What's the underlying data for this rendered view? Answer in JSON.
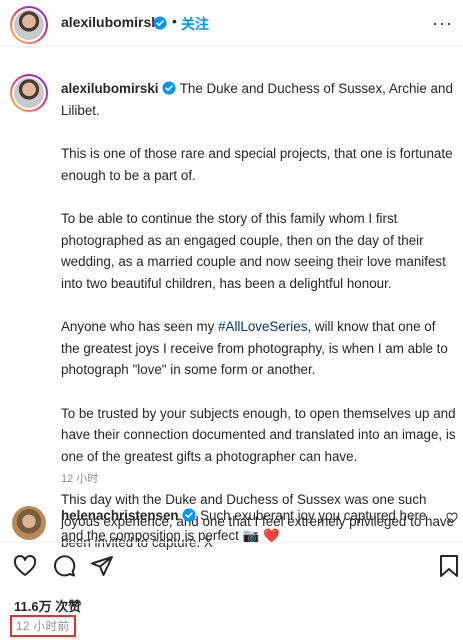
{
  "header": {
    "username": "alexilubomirski",
    "dot": "•",
    "follow_label": "关注",
    "more_label": "···"
  },
  "caption": {
    "username": "alexilubomirski",
    "paragraphs": [
      "The Duke and Duchess of Sussex, Archie and Lilibet.",
      "This is one of those rare and special projects, that one is fortunate enough to be a part of.",
      "To be able to continue the story of this family whom I first photographed as an engaged couple, then on the day of their wedding, as a married couple and now seeing their love manifest into two beautiful children, has been a delightful honour.",
      "",
      "To be trusted by your subjects enough, to open themselves up and have their connection documented and translated into an image, is one of the greatest gifts a photographer can have.",
      "This day with the Duke and Duchess of Sussex was one such joyous experience, and one that I feel extremely privileged to have been invited to capture. X"
    ],
    "p4_before": "Anyone who has seen my ",
    "hashtag": "#AllLoveSeries",
    "p4_after": ", will know that one of the greatest joys I receive from photography, is when I am able to photograph \"love\" in some form or another.",
    "time": "12 小时"
  },
  "comment": {
    "username": "helenachristensen",
    "text": "Such exuberant joy you captured here and the composition is perfect",
    "emojis": "📷 ❤️"
  },
  "actions": {
    "icons": [
      "heart-icon",
      "comment-icon",
      "share-icon",
      "bookmark-icon"
    ]
  },
  "likes_label": "11.6万 次赞",
  "post_time": "12 小时前",
  "colors": {
    "link": "#0095f6",
    "hashtag": "#00376b",
    "highlight": "#e0322c"
  }
}
